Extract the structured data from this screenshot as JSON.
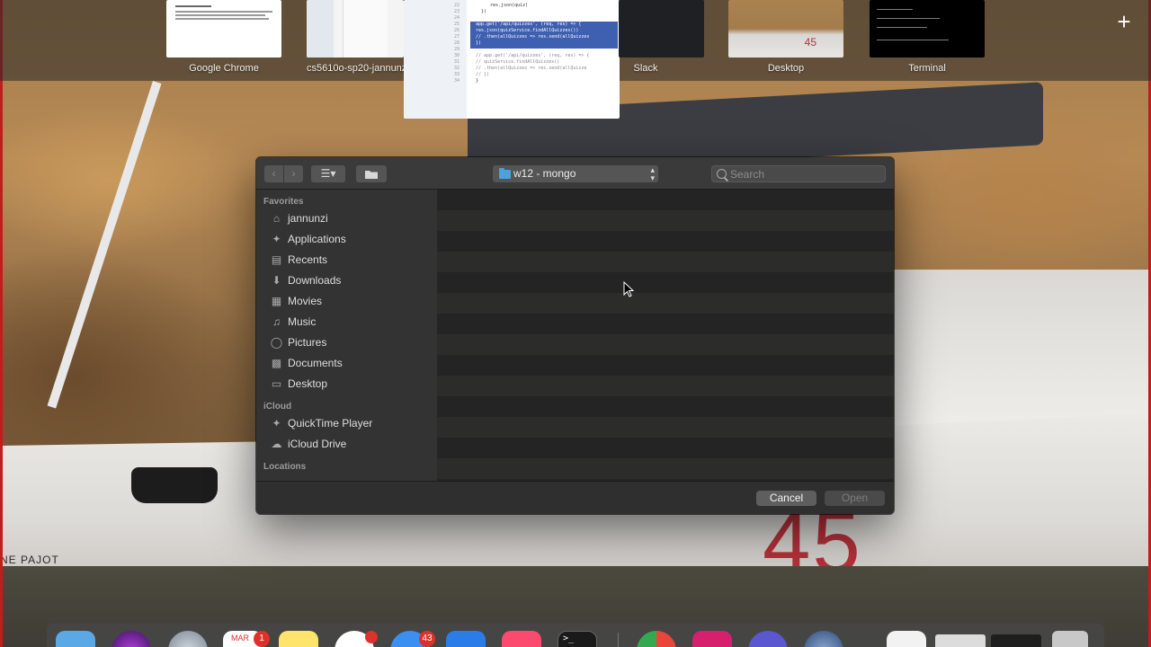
{
  "mission_control": {
    "spaces": [
      {
        "label": "Google Chrome"
      },
      {
        "label": "cs5610o-sp20-jannunzi"
      },
      {
        "label": "Slack"
      },
      {
        "label": "Desktop"
      },
      {
        "label": "Terminal"
      }
    ],
    "code_preview": {
      "line_numbers": [
        "22",
        "23",
        "24",
        "25",
        "26",
        "27",
        "28",
        "29",
        "30",
        "31",
        "32",
        "33",
        "34"
      ],
      "lines": [
        "res.json(quiz)",
        "})",
        "",
        "app.get('/api/quizzes', (req, res) => {",
        "  res.json(quizService.findAllQuizzes())",
        "  // .then(allQuizzes => res.send(allQuizzes",
        "})",
        "",
        "// app.get('/api/quizzes', (req, res) => {",
        "//    quizService.findAllQuizzes()",
        "//      .then(allQuizzes => res.send(allQuizze",
        "// })",
        "}"
      ]
    },
    "desktop_thumb_number": "45"
  },
  "wallpaper": {
    "hull_number": "45",
    "hull_brand": "NE PAJOT"
  },
  "dialog": {
    "path_popup": {
      "label": "w12 - mongo",
      "folder_color": "#4aa3e0"
    },
    "search": {
      "placeholder": "Search",
      "value": ""
    },
    "sidebar": {
      "sections": [
        {
          "title": "Favorites",
          "items": [
            {
              "label": "jannunzi",
              "icon": "home-icon"
            },
            {
              "label": "Applications",
              "icon": "applications-icon"
            },
            {
              "label": "Recents",
              "icon": "recents-icon"
            },
            {
              "label": "Downloads",
              "icon": "downloads-icon"
            },
            {
              "label": "Movies",
              "icon": "movies-icon"
            },
            {
              "label": "Music",
              "icon": "music-icon"
            },
            {
              "label": "Pictures",
              "icon": "pictures-icon"
            },
            {
              "label": "Documents",
              "icon": "documents-icon"
            },
            {
              "label": "Desktop",
              "icon": "desktop-icon"
            }
          ]
        },
        {
          "title": "iCloud",
          "items": [
            {
              "label": "QuickTime Player",
              "icon": "quicktime-icon"
            },
            {
              "label": "iCloud Drive",
              "icon": "icloud-icon"
            }
          ]
        },
        {
          "title": "Locations",
          "items": []
        }
      ]
    },
    "buttons": {
      "cancel": "Cancel",
      "open": "Open"
    }
  },
  "dock": {
    "calendar_month": "MAR",
    "badges": {
      "calendar": "1",
      "mail": "43"
    },
    "terminal_prompt": ">_"
  },
  "colors": {
    "dialog_bg": "#2a2a2a",
    "sidebar_bg": "#333333",
    "accent_folder": "#4aa3e0",
    "hull_number": "#b5313a",
    "badge": "#e0302a"
  }
}
